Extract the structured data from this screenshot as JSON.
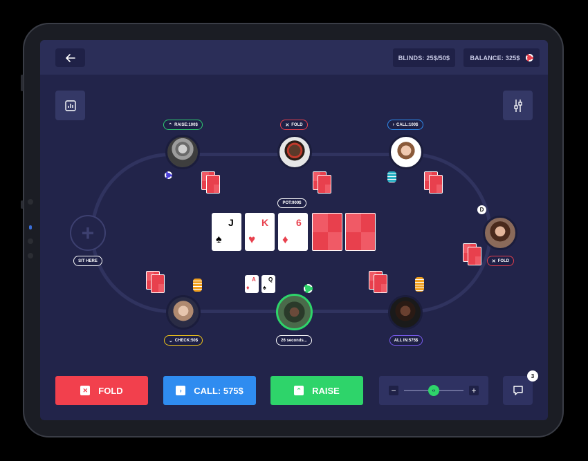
{
  "header": {
    "blinds": "BLINDS: 25$/50$",
    "balance": "BALANCE: 325$"
  },
  "table": {
    "pot": "POT:900$",
    "sit_here": "SIT HERE",
    "dealer_marker": "D",
    "community_cards": [
      {
        "rank": "J",
        "suit": "♠",
        "color": "#111111"
      },
      {
        "rank": "K",
        "suit": "♥",
        "color": "#e8404d"
      },
      {
        "rank": "6",
        "suit": "♦",
        "color": "#e8404d"
      }
    ],
    "hole_cards": [
      {
        "rank": "A",
        "suit": "♦",
        "color": "#e8404d"
      },
      {
        "rank": "Q",
        "suit": "♠",
        "color": "#111111"
      }
    ]
  },
  "players": [
    {
      "id": "top-left",
      "tag": "RAISE:100$",
      "tag_icon": "^",
      "tag_color": "#2ecc71"
    },
    {
      "id": "top-center",
      "tag": "FOLD",
      "tag_icon": "×",
      "tag_color": "#e8404d"
    },
    {
      "id": "top-right",
      "tag": "CALL:100$",
      "tag_icon": ">",
      "tag_color": "#2f8cf0"
    },
    {
      "id": "right",
      "tag": "FOLD",
      "tag_icon": "×",
      "tag_color": "#e8404d"
    },
    {
      "id": "bottom-left",
      "tag": "CHECK:50$",
      "tag_icon": "v",
      "tag_color": "#f0c419"
    },
    {
      "id": "bottom-center",
      "tag": "26 seconds...",
      "tag_icon": "",
      "tag_color": "#ffffff"
    },
    {
      "id": "bottom-right",
      "tag": "ALL IN:575$",
      "tag_icon": "",
      "tag_color": "#7a5cf0"
    }
  ],
  "actions": {
    "fold": "FOLD",
    "call": "CALL: 575$",
    "raise": "RAISE",
    "raise_slider_level": 0.5,
    "minus": "−",
    "plus": "+"
  },
  "chat": {
    "badge": "3"
  },
  "colors": {
    "fold": "#f2404d",
    "call": "#2f8cf0",
    "raise": "#2ed46a",
    "background": "#22244a"
  }
}
